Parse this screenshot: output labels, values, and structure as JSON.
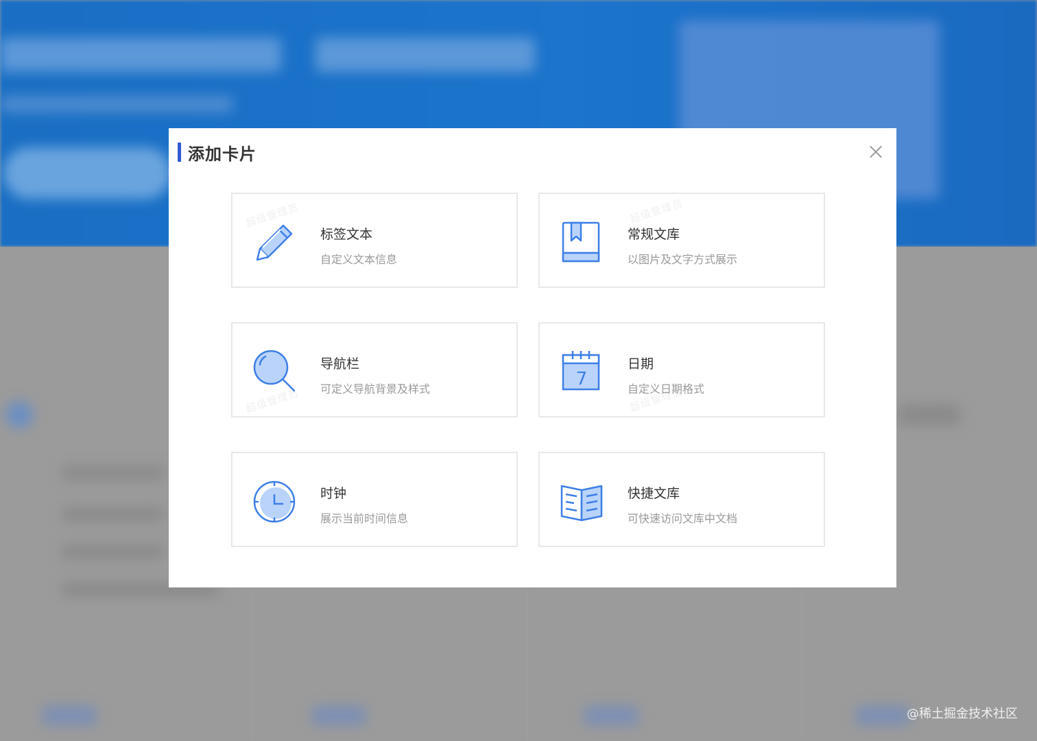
{
  "modal": {
    "title": "添加卡片",
    "close_label": "×"
  },
  "cards": [
    {
      "title": "标签文本",
      "desc": "自定义文本信息",
      "icon": "pencil-icon"
    },
    {
      "title": "常规文库",
      "desc": "以图片及文字方式展示",
      "icon": "book-icon"
    },
    {
      "title": "导航栏",
      "desc": "可定义导航背景及样式",
      "icon": "magnifier-icon"
    },
    {
      "title": "日期",
      "desc": "自定义日期格式",
      "icon": "calendar-icon"
    },
    {
      "title": "时钟",
      "desc": "展示当前时间信息",
      "icon": "clock-icon"
    },
    {
      "title": "快捷文库",
      "desc": "可快速访问文库中文档",
      "icon": "open-book-icon"
    }
  ],
  "calendar_day": "7",
  "watermark_text": "超级管理员",
  "site_mark": "@稀土掘金技术社区",
  "colors": {
    "accent": "#2f5bd3",
    "icon_blue": "#3d7ee6",
    "icon_fill": "#b9d3fb",
    "banner_blue": "#1a6fc4",
    "overlay_gray": "#9b9b9b"
  }
}
